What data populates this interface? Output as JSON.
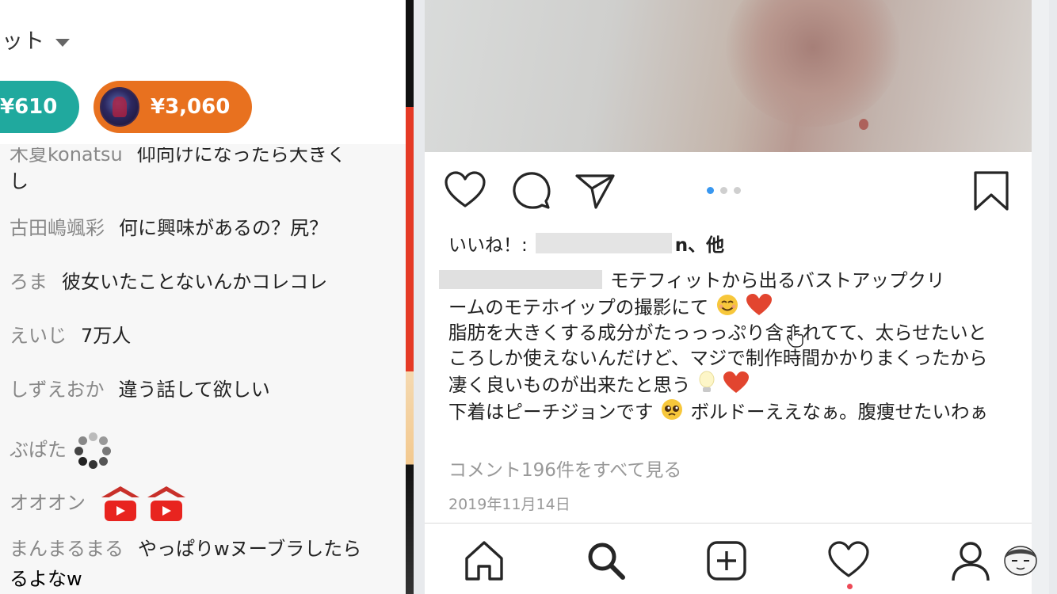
{
  "chat": {
    "header_title": "ット",
    "superchats": [
      {
        "amount": "¥610",
        "color": "#20a99e"
      },
      {
        "amount": "¥3,060",
        "color": "#e8711f"
      }
    ],
    "messages": [
      {
        "author": "木夏konatsu",
        "text": "仰向けになったら大きく",
        "cont": "し"
      },
      {
        "author": "古田嶋颯彩",
        "text": "何に興味があるの？尻？"
      },
      {
        "author": "ろま",
        "text": "彼女いたことないんかコレコレ"
      },
      {
        "author": "えいじ",
        "text": "7万人"
      },
      {
        "author": "しずえおか",
        "text": "違う話して欲しい"
      },
      {
        "author": "ぶぱた",
        "text": "",
        "emote": "loading-spinner-emote"
      },
      {
        "author": "オオオン",
        "text": "",
        "emote": "youtube-house-emote"
      },
      {
        "author": "まんまるまる",
        "text": "やっぱりwヌーブラしたら",
        "cont": "るよなw"
      }
    ]
  },
  "post": {
    "likes_prefix": "いいね！: ",
    "likes_suffix": "n、他",
    "caption": {
      "line1": "モテフィットから出るバストアップクリ",
      "line2": "ームのモテホイップの撮影にて",
      "para2": "脂肪を大きくする成分がたっっっぷり含まれてて、太らせたいところしか使えないんだけど、マジで制作時間かかりまくったから凄く良いものが出来たと思う",
      "para3": "下着はピーチジョンです",
      "para3b": "ボルドーええなぁ。腹痩せたいわぁ"
    },
    "comments_link": "コメント196件をすべて見る",
    "date": "2019年11月14日",
    "carousel": {
      "count": 3,
      "active": 1
    },
    "accent_color": "#3897f0",
    "notification_color": "#ed4956",
    "icons": [
      "heart-icon",
      "comment-icon",
      "share-icon",
      "bookmark-icon",
      "home-icon",
      "search-icon",
      "add-post-icon",
      "activity-heart-icon",
      "profile-icon"
    ]
  }
}
